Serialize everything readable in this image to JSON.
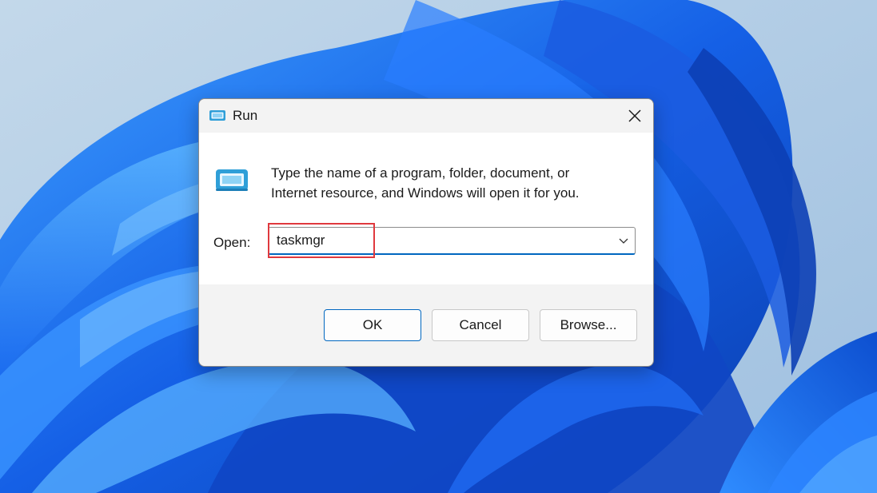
{
  "dialog": {
    "title": "Run",
    "description_line1": "Type the name of a program, folder, document, or",
    "description_line2": "Internet resource, and Windows will open it for you.",
    "open_label": "Open:",
    "open_value": "taskmgr"
  },
  "buttons": {
    "ok": "OK",
    "cancel": "Cancel",
    "browse": "Browse..."
  },
  "icons": {
    "title": "run-icon",
    "close": "close-icon",
    "dialog": "run-icon",
    "dropdown": "chevron-down-icon"
  },
  "colors": {
    "accent": "#0067c0",
    "highlight_box": "#e0393e",
    "wallpaper_blue": "#1a5fd8"
  }
}
